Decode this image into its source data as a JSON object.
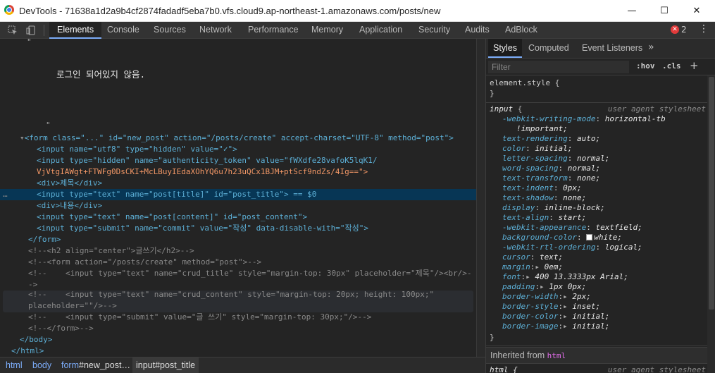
{
  "window": {
    "title": "DevTools - 71638a1d2a9b4cf2874fadadf5eba7b0.vfs.cloud9.ap-northeast-1.amazonaws.com/posts/new",
    "minimize_glyph": "—",
    "maximize_glyph": "☐",
    "close_glyph": "✕"
  },
  "toolbar": {
    "inspect_icon": "inspect-element-icon",
    "device_icon": "device-toolbar-icon",
    "tabs": [
      "Elements",
      "Console",
      "Sources",
      "Network",
      "Performance",
      "Memory",
      "Application",
      "Security",
      "Audits",
      "AdBlock"
    ],
    "active_tab": "Elements",
    "error_count": "2",
    "kebab_glyph": "⋮"
  },
  "elements": {
    "quote_top": "\"",
    "rendered_text": "로그인 되어있지 않음.",
    "quote_mid": "\"",
    "ellipsis": "…",
    "lines": [
      {
        "text": "<form class=\"...\" id=\"new_post\" action=\"/posts/create\" accept-charset=\"UTF-8\" method=\"post\">"
      },
      {
        "text": "<input name=\"utf8\" type=\"hidden\" value=\"✓\">"
      },
      {
        "text": "<input type=\"hidden\" name=\"authenticity_token\" value=\"fWXdfe28vafoK5lqK1/"
      },
      {
        "text": "VjVtgIAWgt+FTWFg0DsCKI+McLBuyIEdaXOhYQ6u7h23uQCx1BJM+ptScf9ndZs/4Ig==\">"
      },
      {
        "text": "<div>제목</div>"
      },
      {
        "text": "<input type=\"text\" name=\"post[title]\" id=\"post_title\"> == $0"
      },
      {
        "text": "<div>내용</div>"
      },
      {
        "text": "<input type=\"text\" name=\"post[content]\" id=\"post_content\">"
      },
      {
        "text": "<input type=\"submit\" name=\"commit\" value=\"작성\" data-disable-with=\"작성\">"
      },
      {
        "text": "</form>"
      },
      {
        "text": "<!--<h2 align=\"center\">글쓰기</h2>-->"
      },
      {
        "text": "<!--<form action=\"/posts/create\" method=\"post\">-->"
      },
      {
        "text": "<!--    <input type=\"text\" name=\"crud_title\" style=\"margin-top: 30px\" placeholder=\"제목\"/><br/>-"
      },
      {
        "text": "->"
      },
      {
        "text": "<!--    <input type=\"text\" name=\"crud_content\" style=\"margin-top: 20px; height: 100px;\""
      },
      {
        "text": "placeholder=\"\"/>-->"
      },
      {
        "text": "<!--    <input type=\"submit\" value=\"글 쓰기\" style=\"margin-top: 30px;\"/>-->"
      },
      {
        "text": "<!--</form>-->"
      },
      {
        "text": "</body>"
      },
      {
        "text": "</html>"
      }
    ]
  },
  "breadcrumbs": [
    {
      "tag": "html",
      "hash": ""
    },
    {
      "tag": "body",
      "hash": ""
    },
    {
      "tag": "form",
      "hash": "#new_post…"
    },
    {
      "tag": "input",
      "hash": "#post_title"
    }
  ],
  "sidebar": {
    "tabs": [
      "Styles",
      "Computed",
      "Event Listeners"
    ],
    "active_tab": "Styles",
    "more_glyph": "»",
    "filter_placeholder": "Filter",
    "hov_label": ":hov",
    "cls_label": ".cls",
    "add_glyph": "+",
    "element_style_open": "element.style {",
    "element_style_close": "}",
    "rule_selector": "input",
    "rule_brace": "{",
    "rule_source": "user agent stylesheet",
    "declarations": [
      {
        "prop": "-webkit-writing-mode",
        "value": "horizontal-tb"
      },
      {
        "prop": "",
        "value": "!important;"
      },
      {
        "prop": "text-rendering",
        "value": "auto;"
      },
      {
        "prop": "color",
        "value": "initial;"
      },
      {
        "prop": "letter-spacing",
        "value": "normal;"
      },
      {
        "prop": "word-spacing",
        "value": "normal;"
      },
      {
        "prop": "text-transform",
        "value": "none;"
      },
      {
        "prop": "text-indent",
        "value": "0px;"
      },
      {
        "prop": "text-shadow",
        "value": "none;"
      },
      {
        "prop": "display",
        "value": "inline-block;"
      },
      {
        "prop": "text-align",
        "value": "start;"
      },
      {
        "prop": "-webkit-appearance",
        "value": "textfield;"
      },
      {
        "prop": "background-color",
        "value": "white;"
      },
      {
        "prop": "-webkit-rtl-ordering",
        "value": "logical;"
      },
      {
        "prop": "cursor",
        "value": "text;"
      },
      {
        "prop": "margin",
        "value": "0em;"
      },
      {
        "prop": "font",
        "value": "400 13.3333px Arial;"
      },
      {
        "prop": "padding",
        "value": "1px 0px;"
      },
      {
        "prop": "border-width",
        "value": "2px;"
      },
      {
        "prop": "border-style",
        "value": "inset;"
      },
      {
        "prop": "border-color",
        "value": "initial;"
      },
      {
        "prop": "border-image",
        "value": "initial;"
      }
    ],
    "rule_close": "}",
    "inherited_label": "Inherited from",
    "inherited_tag": "html",
    "next_selector": "html {",
    "next_source": "user agent stylesheet"
  }
}
